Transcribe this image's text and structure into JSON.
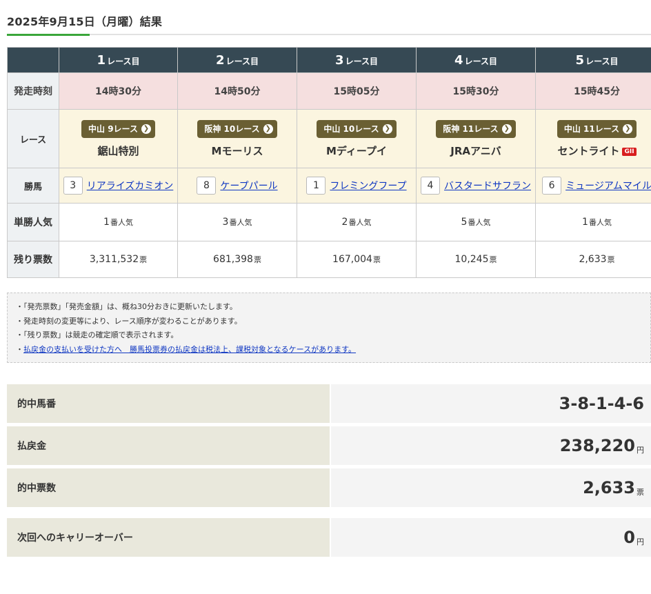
{
  "page": {
    "title": "2025年9月15日（月曜）結果"
  },
  "table": {
    "races": [
      {
        "num": "1",
        "suffix": "レース目",
        "time": "14時30分",
        "venue": "中山 9レース",
        "name": "鋸山特別",
        "grade": "",
        "horse_num": "3",
        "horse_name": "リアライズカミオン",
        "pop_num": "1",
        "pop_unit": "番人気",
        "votes": "3,311,532",
        "votes_unit": "票"
      },
      {
        "num": "2",
        "suffix": "レース目",
        "time": "14時50分",
        "venue": "阪神 10レース",
        "name": "Mモーリス",
        "grade": "",
        "horse_num": "8",
        "horse_name": "ケープパール",
        "pop_num": "3",
        "pop_unit": "番人気",
        "votes": "681,398",
        "votes_unit": "票"
      },
      {
        "num": "3",
        "suffix": "レース目",
        "time": "15時05分",
        "venue": "中山 10レース",
        "name": "Mディープイ",
        "grade": "",
        "horse_num": "1",
        "horse_name": "フレミングフープ",
        "pop_num": "2",
        "pop_unit": "番人気",
        "votes": "167,004",
        "votes_unit": "票"
      },
      {
        "num": "4",
        "suffix": "レース目",
        "time": "15時30分",
        "venue": "阪神 11レース",
        "name": "JRAアニバ",
        "grade": "",
        "horse_num": "4",
        "horse_name": "バスタードサフラン",
        "pop_num": "5",
        "pop_unit": "番人気",
        "votes": "10,245",
        "votes_unit": "票"
      },
      {
        "num": "5",
        "suffix": "レース目",
        "time": "15時45分",
        "venue": "中山 11レース",
        "name": "セントライト",
        "grade": "GII",
        "horse_num": "6",
        "horse_name": "ミュージアムマイル",
        "pop_num": "1",
        "pop_unit": "番人気",
        "votes": "2,633",
        "votes_unit": "票"
      }
    ],
    "row_labels": {
      "time": "発走時刻",
      "race": "レース",
      "winner": "勝馬",
      "popularity": "単勝人気",
      "votes": "残り票数"
    }
  },
  "notes": [
    "「発売票数」「発売金額」は、概ね30分おきに更新いたします。",
    "発走時刻の変更等により、レース順序が変わることがあります。",
    "「残り票数」は競走の確定順で表示されます。"
  ],
  "notes_link": "払戻金の支払いを受けた方へ　勝馬投票券の払戻金は税法上、課税対象となるケースがあります。",
  "summary": {
    "combo_label": "的中馬番",
    "combo_value": "3-8-1-4-6",
    "payout_label": "払戻金",
    "payout_value": "238,220",
    "payout_unit": "円",
    "hits_label": "的中票数",
    "hits_value": "2,633",
    "hits_unit": "票",
    "carry_label": "次回へのキャリーオーバー",
    "carry_value": "0",
    "carry_unit": "円"
  },
  "colors": {
    "header_bg": "#364954",
    "time_row_bg": "#f5dfdf",
    "race_row_bg": "#fbf5e0",
    "venue_badge": "#6a5f33",
    "accent": "#3aa63a",
    "link": "#0f37c2",
    "grade_badge": "#d81e1e"
  },
  "icons": {
    "venue_chevron": "chevron-right-circle-icon"
  }
}
